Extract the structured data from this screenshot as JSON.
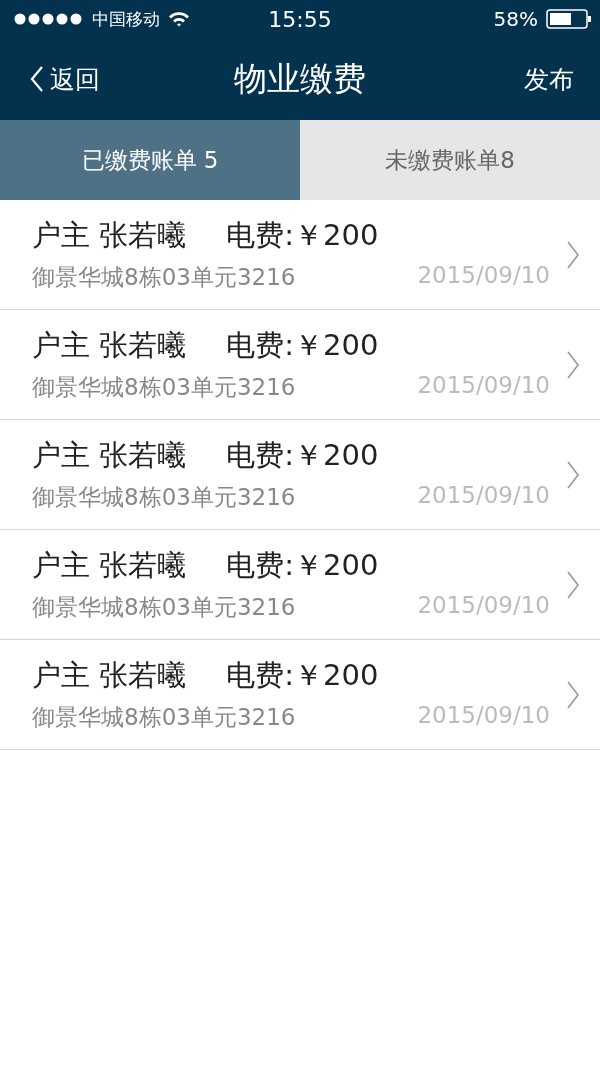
{
  "status_bar": {
    "carrier": "中国移动",
    "time": "15:55",
    "battery": "58%"
  },
  "nav": {
    "back": "返回",
    "title": "物业缴费",
    "action": "发布"
  },
  "tabs": [
    {
      "label": "已缴费账单  5",
      "selected": true
    },
    {
      "label": "未缴费账单8",
      "selected": false
    }
  ],
  "bills": [
    {
      "owner": "户主 张若曦",
      "fee": "电费:￥200",
      "address": "御景华城8栋03单元3216",
      "date": "2015/09/10"
    },
    {
      "owner": "户主 张若曦",
      "fee": "电费:￥200",
      "address": "御景华城8栋03单元3216",
      "date": "2015/09/10"
    },
    {
      "owner": "户主 张若曦",
      "fee": "电费:￥200",
      "address": "御景华城8栋03单元3216",
      "date": "2015/09/10"
    },
    {
      "owner": "户主 张若曦",
      "fee": "电费:￥200",
      "address": "御景华城8栋03单元3216",
      "date": "2015/09/10"
    },
    {
      "owner": "户主 张若曦",
      "fee": "电费:￥200",
      "address": "御景华城8栋03单元3216",
      "date": "2015/09/10"
    }
  ]
}
